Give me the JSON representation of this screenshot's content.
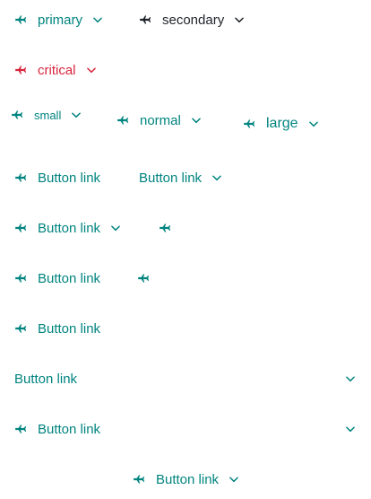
{
  "colors": {
    "primary": "#00847f",
    "secondary": "#1f2328",
    "critical": "#d7263d"
  },
  "icons": {
    "leading": "airplane-icon",
    "trailing": "chevron-down-icon"
  },
  "row1": {
    "primary_label": "primary",
    "secondary_label": "secondary"
  },
  "row2": {
    "critical_label": "critical"
  },
  "row3": {
    "small_label": "small",
    "normal_label": "normal",
    "large_label": "large"
  },
  "rows": {
    "r4a": "Button link",
    "r4b": "Button link",
    "r5a": "Button link",
    "r6a": "Button link",
    "r7a": "Button link",
    "r8a": "Button link",
    "r9a": "Button link",
    "r10a": "Button link"
  }
}
